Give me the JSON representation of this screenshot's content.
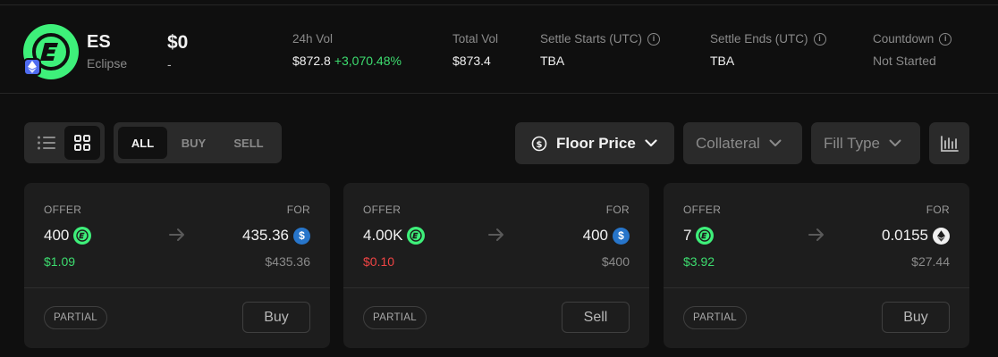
{
  "token": {
    "ticker": "ES",
    "name": "Eclipse",
    "price": "$0",
    "price_change": "-",
    "logo_icon": "eclipse-logo-icon",
    "chain_icon": "ethereum-icon",
    "colors": {
      "brand": "#3ef07a",
      "chain": "#4f6cf0"
    }
  },
  "stats": {
    "vol24h": {
      "label": "24h Vol",
      "value": "$872.8",
      "change": "+3,070.48%"
    },
    "total_vol": {
      "label": "Total Vol",
      "value": "$873.4"
    },
    "settle_starts": {
      "label": "Settle Starts (UTC)",
      "value": "TBA"
    },
    "settle_ends": {
      "label": "Settle Ends (UTC)",
      "value": "TBA"
    },
    "countdown": {
      "label": "Countdown",
      "value": "Not Started"
    }
  },
  "toolbar": {
    "view_modes": [
      "list-view-icon",
      "grid-view-icon"
    ],
    "active_view": "grid",
    "side_tabs": [
      "ALL",
      "BUY",
      "SELL"
    ],
    "active_side": "ALL",
    "sort": {
      "label": "Floor Price",
      "icon": "dollar-circle-icon"
    },
    "collateral": "Collateral",
    "fill_type": "Fill Type",
    "chart_icon": "depth-chart-icon"
  },
  "labels": {
    "offer": "OFFER",
    "for": "FOR",
    "partial": "PARTIAL"
  },
  "offers": [
    {
      "offer_amount": "400",
      "offer_usd": "$1.09",
      "offer_usd_trend": "up",
      "for_amount": "435.36",
      "for_usd": "$435.36",
      "for_token": "usdc",
      "action": "Buy"
    },
    {
      "offer_amount": "4.00K",
      "offer_usd": "$0.10",
      "offer_usd_trend": "down",
      "for_amount": "400",
      "for_usd": "$400",
      "for_token": "usdc",
      "action": "Sell"
    },
    {
      "offer_amount": "7",
      "offer_usd": "$3.92",
      "offer_usd_trend": "up",
      "for_amount": "0.0155",
      "for_usd": "$27.44",
      "for_token": "eth",
      "action": "Buy"
    }
  ],
  "colors": {
    "positive": "#3ddc6f",
    "negative": "#ef4444",
    "background": "#0f0f0f",
    "card": "#1d1d1d"
  }
}
